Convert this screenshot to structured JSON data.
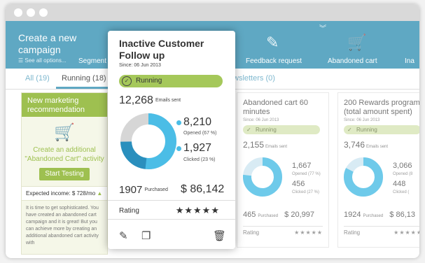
{
  "toolbar": {
    "title": "Create a new campaign",
    "see_all": "☰ See all options...",
    "items": [
      "Segment",
      "Feedback request",
      "Abandoned cart",
      "Ina"
    ]
  },
  "tabs": {
    "all": "All (19)",
    "running": "Running (18)",
    "newsletters": "wsletters (0)"
  },
  "promo": {
    "title": "New marketing recommendation",
    "text": "Create an additional \"Abandoned Cart\" activity",
    "button": "Start Testing",
    "income": "Expected income: $ 728/mo",
    "body": "It is time to get sophisticated. You have created an abandoned cart campaign and it is great! But you can achieve more by creating an additional abandoned cart activity with"
  },
  "popup": {
    "title": "Inactive Customer Follow up",
    "since": "Since: 06 Jun 2013",
    "status": "Running",
    "emails_sent": "12,268",
    "emails_sent_label": "Emails sent",
    "opened": "8,210",
    "opened_label": "Opened (67 %)",
    "clicked": "1,927",
    "clicked_label": "Clicked (23 %)",
    "purchased": "1907",
    "purchased_label": "Purchased",
    "amount": "$ 86,142",
    "rating_label": "Rating",
    "stars": "★★★★★"
  },
  "cards": [
    {
      "title": "Abandoned cart 60 minutes",
      "since": "Since: 06 Jun 2013",
      "status": "Running",
      "sent": "2,155",
      "sent_label": "Emails sent",
      "opened": "1,667",
      "opened_label": "Opened (77 %)",
      "clicked": "456",
      "clicked_label": "Clicked (27 %)",
      "purchased": "465",
      "purchased_label": "Purchased",
      "amount": "$ 20,997",
      "rating_label": "Rating",
      "stars": "★★★★★"
    },
    {
      "title": "200 Rewards program (total amount spent)",
      "since": "Since: 06 Jun 2013",
      "status": "Running",
      "sent": "3,746",
      "sent_label": "Emails sent",
      "opened": "3,066",
      "opened_label": "Opened (8",
      "clicked": "448",
      "clicked_label": "Clicked (",
      "purchased": "1924",
      "purchased_label": "Purchased",
      "amount": "$ 86,13",
      "rating_label": "Rating",
      "stars": "★★★★★"
    }
  ],
  "colors": {
    "toolbar": "#5fa8c3",
    "green": "#9ec050",
    "donut": "#4bbde6"
  }
}
